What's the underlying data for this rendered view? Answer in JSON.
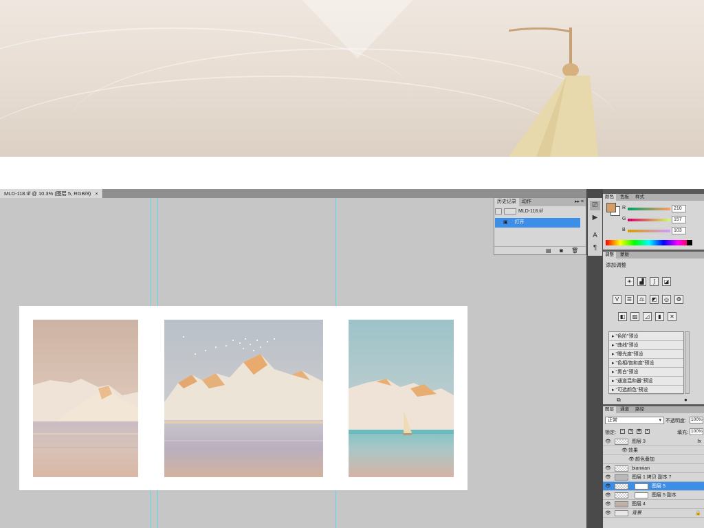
{
  "document": {
    "tab_title": "MLD-118.tif @ 10.3% (图层 5, RGB/8)",
    "close_glyph": "×"
  },
  "history": {
    "tabs": [
      "历史记录",
      "动作"
    ],
    "snapshot_name": "MLD-118.tif",
    "states": [
      "打开"
    ]
  },
  "color_panel": {
    "tabs": [
      "颜色",
      "色板",
      "样式"
    ],
    "channels": [
      {
        "label": "R",
        "value": "210"
      },
      {
        "label": "G",
        "value": "157"
      },
      {
        "label": "B",
        "value": "103"
      }
    ],
    "fg_color": "#d29d67"
  },
  "adjustments": {
    "tabs": [
      "调整",
      "蒙版"
    ],
    "title": "添加调整",
    "presets": [
      "\"色阶\"预设",
      "\"曲线\"预设",
      "\"曝光度\"预设",
      "\"色相/饱和度\"预设",
      "\"黑白\"预设",
      "\"通道混和器\"预设",
      "\"可选颜色\"预设"
    ]
  },
  "layers": {
    "tabs": [
      "图层",
      "通道",
      "路径"
    ],
    "blend_mode": "正常",
    "opacity_label": "不透明度:",
    "opacity_value": "100%",
    "lock_label": "锁定:",
    "fill_label": "填充:",
    "fill_value": "100%",
    "items": [
      {
        "name": "图层 3",
        "fx": "fx"
      },
      {
        "name": "效果"
      },
      {
        "name": "颜色叠加"
      },
      {
        "name": "bianxian"
      },
      {
        "name": "图层 1 拷贝 副本 7"
      },
      {
        "name": "图层 5"
      },
      {
        "name": "图层 5 副本"
      },
      {
        "name": "图层 4"
      },
      {
        "name": "背景"
      }
    ]
  }
}
